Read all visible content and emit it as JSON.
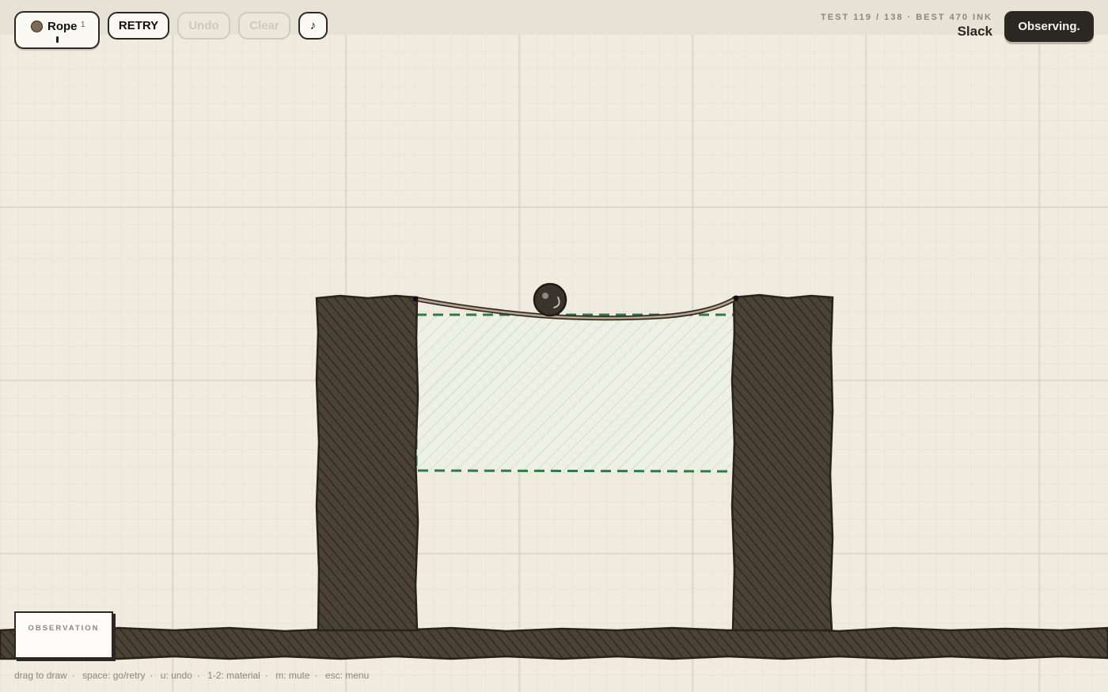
{
  "toolbar": {
    "material": {
      "label": "Rope",
      "count": "1",
      "color": "#7d6b56"
    },
    "retry_label": "RETRY",
    "undo_label": "Undo",
    "clear_label": "Clear",
    "mute_label": "♪"
  },
  "header": {
    "test_info": "TEST 119 / 138 · BEST 470 INK",
    "level_name": "Slack",
    "status": "Observing."
  },
  "observation_panel": {
    "label": "OBSERVATION"
  },
  "hints": [
    "drag to draw",
    "space: go/retry",
    "u: undo",
    "1-2: material",
    "m: mute",
    "esc: menu"
  ],
  "colors": {
    "paper": "#ece8dc",
    "ink": "#2b2722",
    "block_fill": "#4a4235",
    "goal_zone": "#2f7a45",
    "rope": "#7d6b56",
    "grid_major": "#d7d3c6",
    "grid_minor": "#e4e0d4"
  }
}
